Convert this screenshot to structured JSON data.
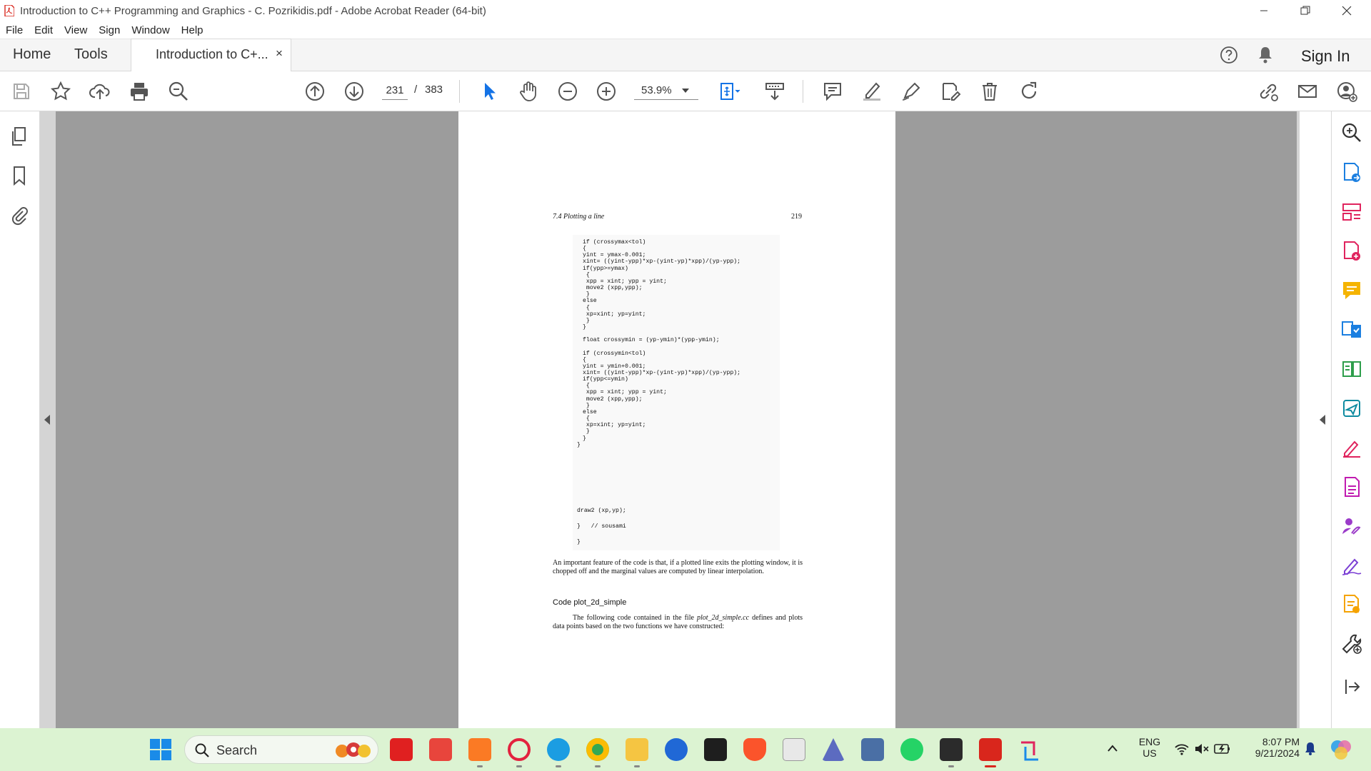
{
  "window": {
    "title": "Introduction to C++ Programming and Graphics - C. Pozrikidis.pdf - Adobe Acrobat Reader (64-bit)"
  },
  "menu": [
    "File",
    "Edit",
    "View",
    "Sign",
    "Window",
    "Help"
  ],
  "tabs": {
    "home": "Home",
    "tools": "Tools",
    "document": "Introduction to C+...",
    "close": "×",
    "sign_in": "Sign In"
  },
  "toolbar": {
    "current_page": "231",
    "separator": "/",
    "total_pages": "383",
    "zoom": "53.9%"
  },
  "page": {
    "running_head": "7.4   Plotting a line",
    "page_number": "219",
    "code_lines": [
      "if (crossymax<tol)",
      "{",
      "yint = ymax-0.001;",
      "xint= ((yint-ypp)*xp-(yint-yp)*xpp)/(yp-ypp);",
      "if(ypp>=ymax)",
      " {",
      " xpp = xint; ypp = yint;",
      " move2 (xpp,ypp);",
      " }",
      "else",
      " {",
      " xp=xint; yp=yint;",
      " }",
      "}",
      "",
      "float crossymin = (yp-ymin)*(ypp-ymin);",
      "",
      "if (crossymin<tol)",
      "{",
      "yint = ymin+0.001;",
      "xint= ((yint-ypp)*xp-(yint-yp)*xpp)/(yp-ypp);",
      "if(ypp<=ymin)",
      " {",
      " xpp = xint; ypp = yint;",
      " move2 (xpp,ypp);",
      " }",
      "else",
      " {",
      " xp=xint; yp=yint;",
      " }",
      "}",
      "}"
    ],
    "code_tail": [
      "draw2 (xp,yp);",
      "}   // sousami",
      "}"
    ],
    "paragraph1": "An important feature of the code is that, if a plotted line exits the plotting window, it is chopped off and the marginal values are computed by linear interpolation.",
    "section_heading": "Code plot_2d_simple",
    "paragraph2_a": "The following code contained in the file ",
    "paragraph2_file": "plot_2d_simple.cc",
    "paragraph2_b": " defines and plots data points based on the two functions we have constructed:"
  },
  "taskbar": {
    "search_placeholder": "Search",
    "lang_top": "ENG",
    "lang_bottom": "US",
    "time": "8:07 PM",
    "date": "9/21/2024"
  },
  "colors": {
    "acrobat_red": "#d9261c",
    "taskbar_bg": "#dcf3d2",
    "accent_blue": "#1473e6",
    "viewer_gray": "#9c9c9c"
  }
}
